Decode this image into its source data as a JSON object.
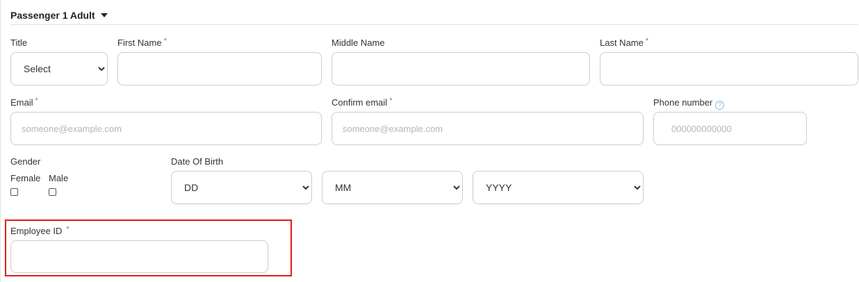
{
  "section": {
    "title": "Passenger 1 Adult",
    "caret_icon": "caret-down-icon"
  },
  "fields": {
    "title": {
      "label": "Title",
      "value": "Select",
      "options": [
        "Select"
      ]
    },
    "first_name": {
      "label": "First Name",
      "required": "*",
      "value": ""
    },
    "middle_name": {
      "label": "Middle Name",
      "value": ""
    },
    "last_name": {
      "label": "Last Name",
      "required": "*",
      "value": ""
    },
    "email": {
      "label": "Email",
      "required": "*",
      "placeholder": "someone@example.com"
    },
    "confirm_email": {
      "label": "Confirm email",
      "required": "*",
      "placeholder": "someone@example.com"
    },
    "phone": {
      "label": "Phone number",
      "help_icon": "question-circle-icon",
      "help_glyph": "?",
      "placeholder": "000000000000"
    },
    "gender": {
      "label": "Gender",
      "female_label": "Female",
      "male_label": "Male"
    },
    "dob": {
      "label": "Date Of Birth",
      "day_value": "DD",
      "month_value": "MM",
      "year_value": "YYYY"
    },
    "employee_id": {
      "label": "Employee ID",
      "required": "*",
      "value": ""
    }
  },
  "colors": {
    "required_star": "#e05050",
    "highlight": "#e01b1b",
    "help_icon": "#8fb8dc"
  }
}
